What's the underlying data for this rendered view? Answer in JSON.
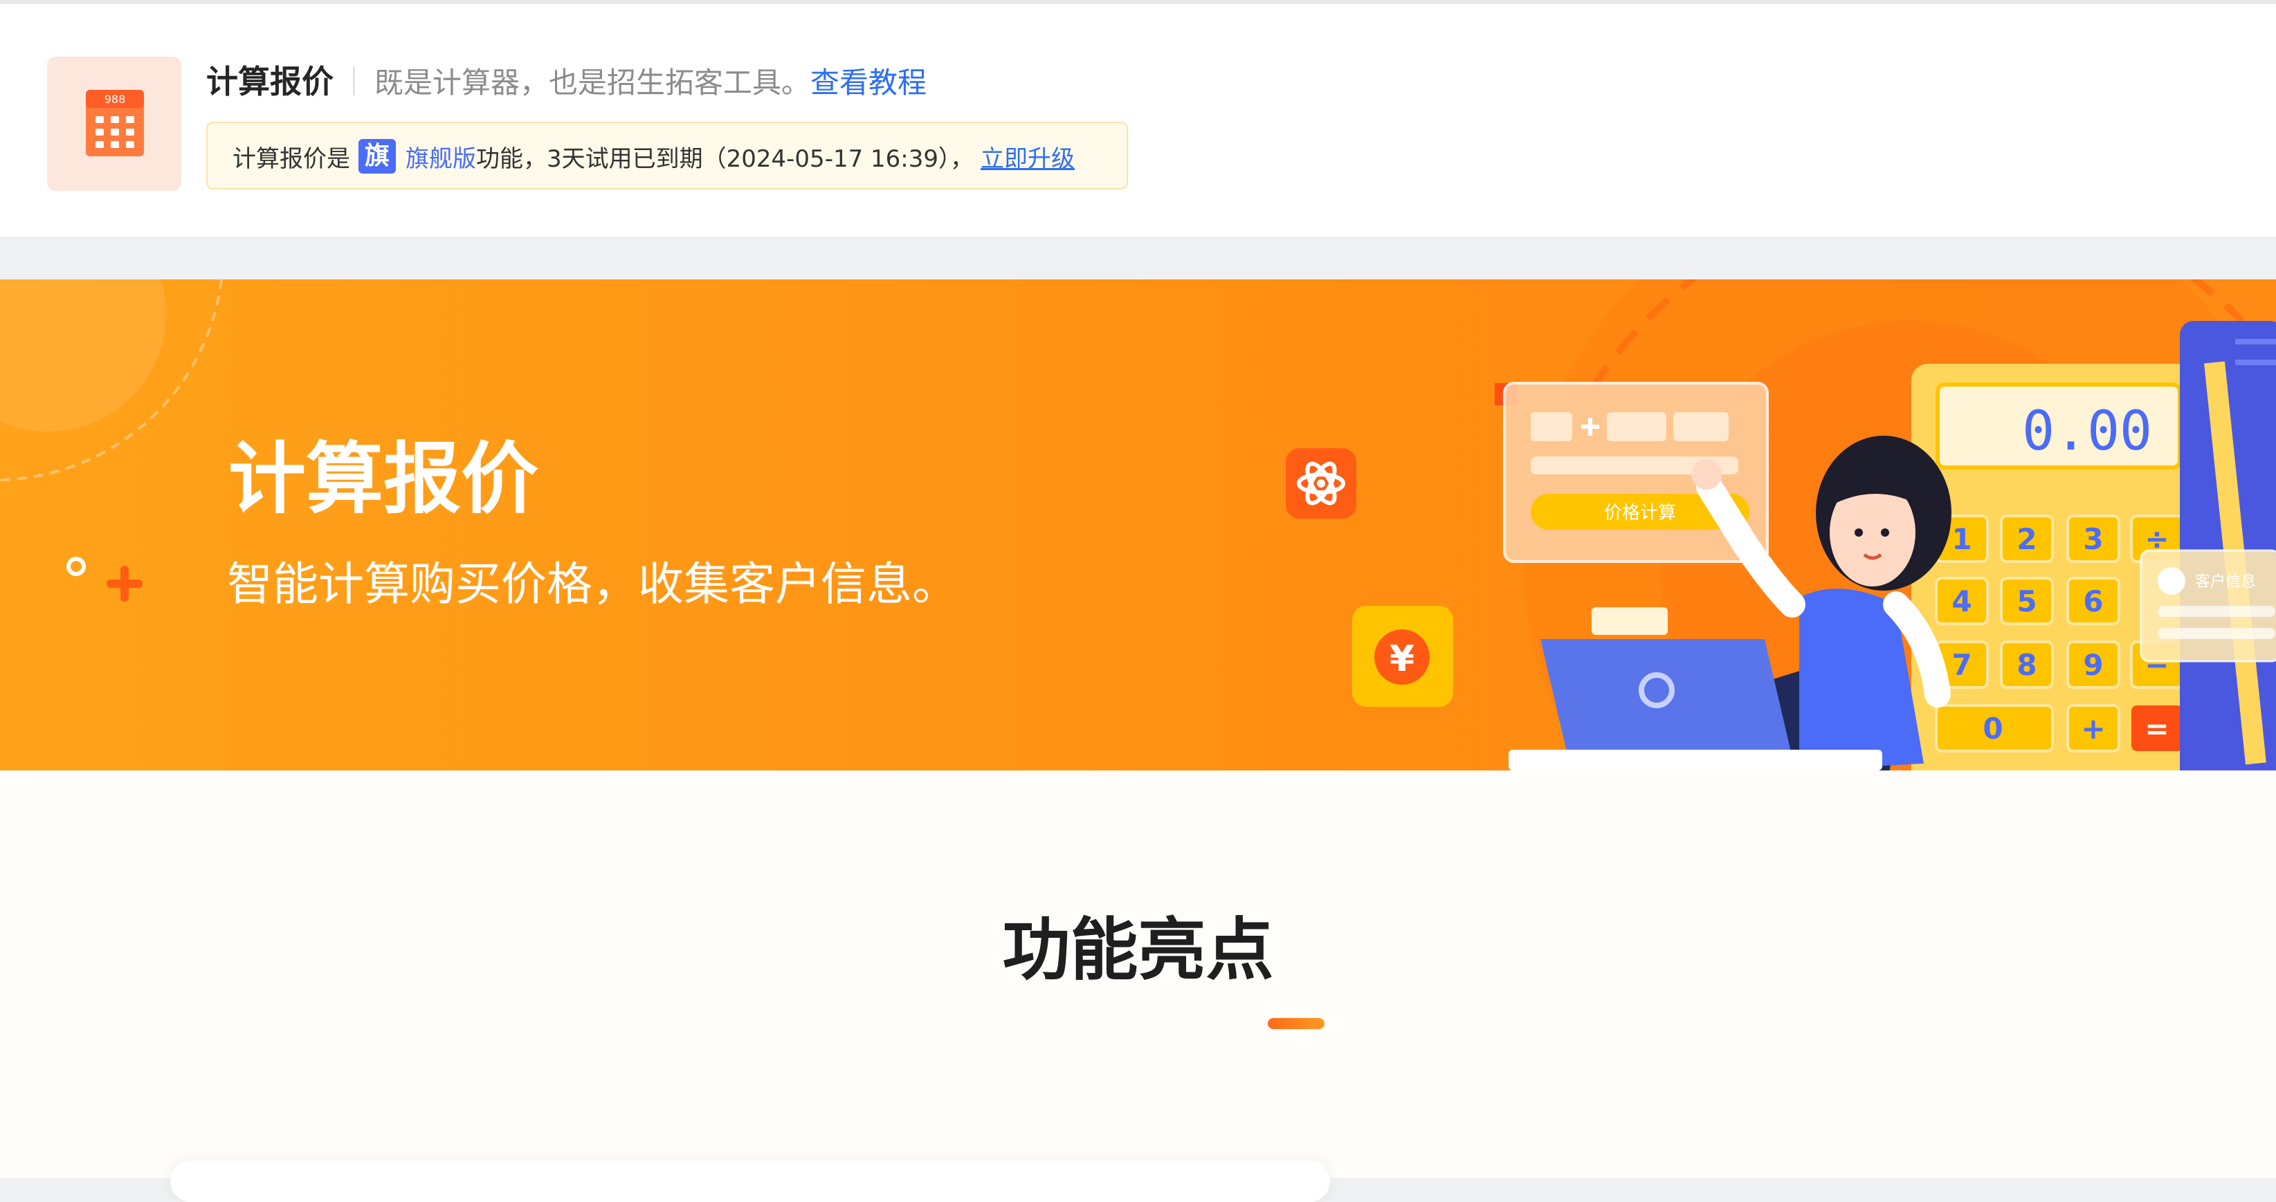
{
  "header": {
    "app_icon_number": "988",
    "title": "计算报价",
    "description": "既是计算器，也是招生拓客工具。",
    "tutorial_link": "查看教程"
  },
  "notice": {
    "prefix": "计算报价是",
    "badge": "旗",
    "edition": "旗舰版",
    "message": "功能，3天试用已到期（2024-05-17 16:39），",
    "upgrade_link": "立即升级"
  },
  "banner": {
    "title": "计算报价",
    "subtitle": "智能计算购买价格，收集客户信息。",
    "calc_display": "0.00",
    "calc_keys": [
      "1",
      "2",
      "3",
      "÷",
      "4",
      "5",
      "6",
      "7",
      "8",
      "9",
      "−",
      "0",
      "+",
      "="
    ],
    "form_button": "价格计算",
    "customer_card": "客户信息",
    "currency_symbol": "¥",
    "colors": {
      "start": "#ffa31a",
      "end": "#ff8a14"
    }
  },
  "section": {
    "title": "功能亮点"
  },
  "icons": [
    "calculator-icon",
    "atom-icon",
    "yuan-coin-icon",
    "laptop-icon",
    "user-icon"
  ]
}
